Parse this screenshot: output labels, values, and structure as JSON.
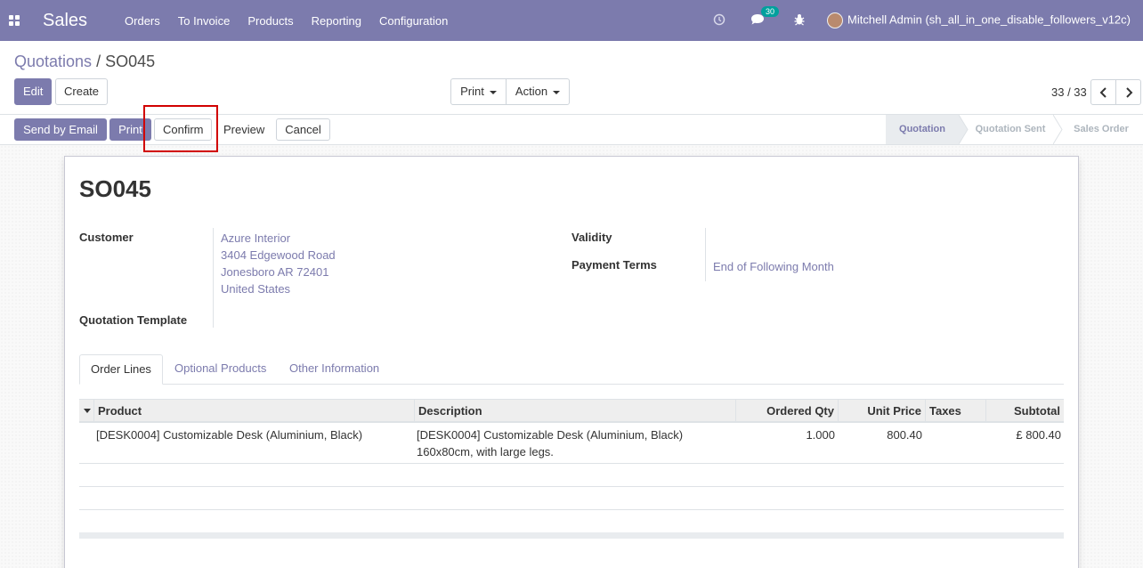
{
  "app": {
    "name": "Sales"
  },
  "menu": [
    "Orders",
    "To Invoice",
    "Products",
    "Reporting",
    "Configuration"
  ],
  "systray": {
    "messages_count": "30",
    "user": "Mitchell Admin (sh_all_in_one_disable_followers_v12c)"
  },
  "breadcrumb": {
    "parent": "Quotations",
    "separator": "/",
    "current": "SO045"
  },
  "toolbar": {
    "edit": "Edit",
    "create": "Create",
    "print": "Print",
    "action": "Action"
  },
  "pager": {
    "value": "33 / 33"
  },
  "actions": {
    "send_email": "Send by Email",
    "print": "Print",
    "confirm": "Confirm",
    "preview": "Preview",
    "cancel": "Cancel"
  },
  "statusbar": {
    "stages": [
      "Quotation",
      "Quotation Sent",
      "Sales Order"
    ],
    "active": "Quotation"
  },
  "order": {
    "name": "SO045",
    "customer_label": "Customer",
    "customer": [
      "Azure Interior",
      "3404 Edgewood Road",
      "Jonesboro AR 72401",
      "United States"
    ],
    "template_label": "Quotation Template",
    "validity_label": "Validity",
    "payment_terms_label": "Payment Terms",
    "payment_terms": "End of Following Month"
  },
  "tabs": [
    "Order Lines",
    "Optional Products",
    "Other Information"
  ],
  "lines": {
    "headers": {
      "product": "Product",
      "description": "Description",
      "qty": "Ordered Qty",
      "price": "Unit Price",
      "taxes": "Taxes",
      "subtotal": "Subtotal"
    },
    "rows": [
      {
        "product": "[DESK0004] Customizable Desk (Aluminium, Black)",
        "description_1": "[DESK0004] Customizable Desk (Aluminium, Black)",
        "description_2": "160x80cm, with large legs.",
        "qty": "1.000",
        "price": "800.40",
        "taxes": "",
        "subtotal": "£ 800.40"
      }
    ]
  },
  "colors": {
    "brand": "#7c7bad",
    "highlight": "#d10000",
    "badge": "#00a09d"
  }
}
